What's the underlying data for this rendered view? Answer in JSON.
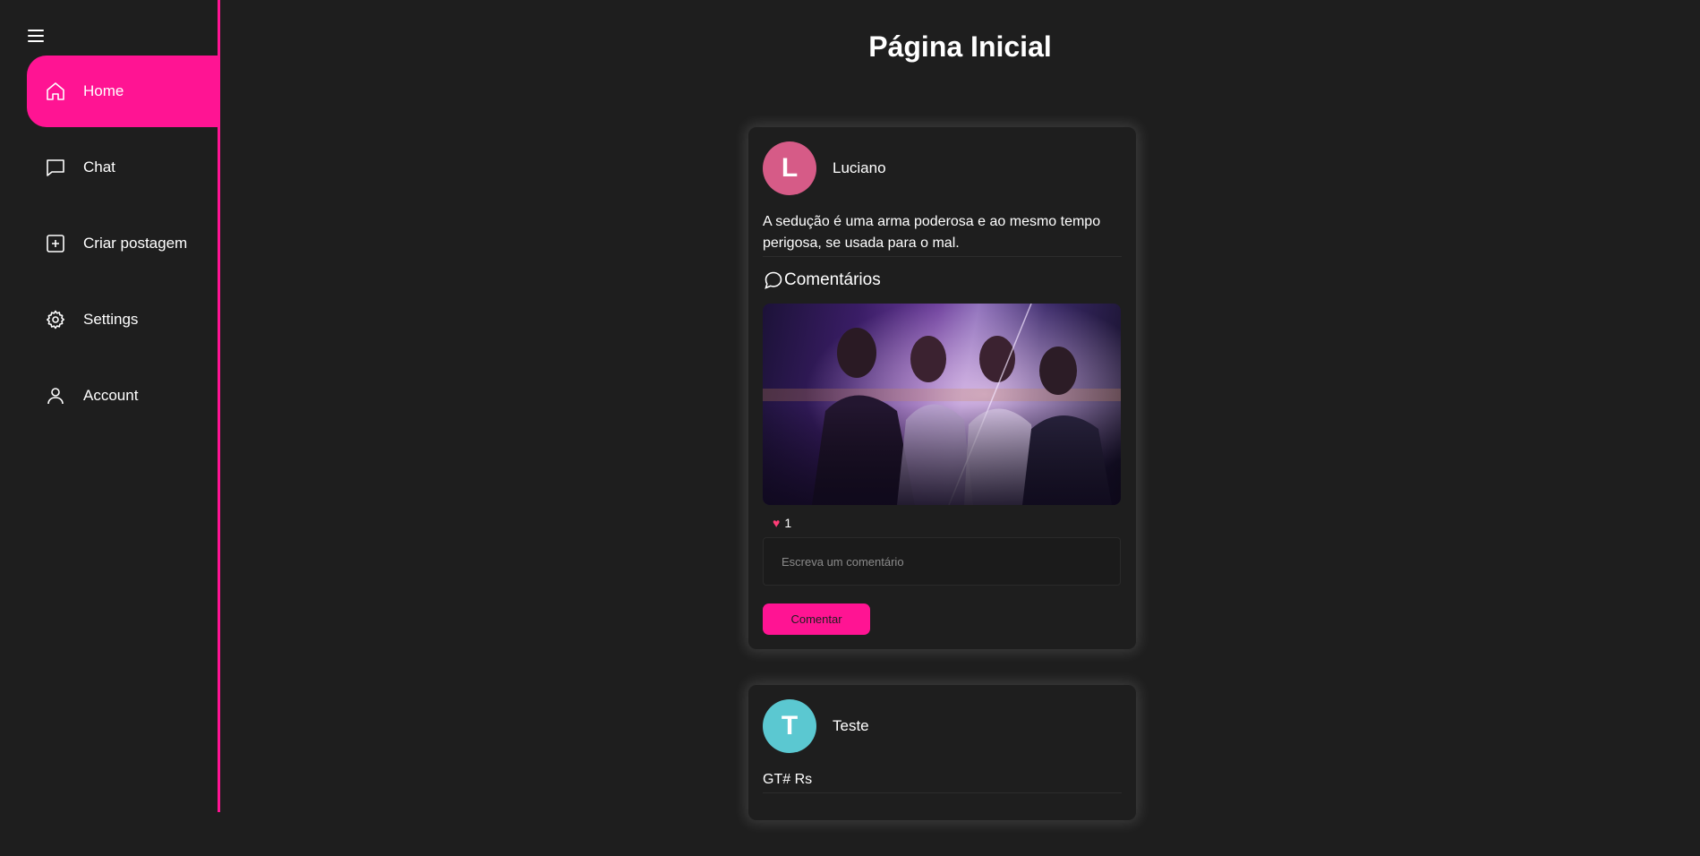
{
  "page": {
    "title": "Página Inicial"
  },
  "sidebar": {
    "items": [
      {
        "label": "Home",
        "icon": "home-icon",
        "active": true
      },
      {
        "label": "Chat",
        "icon": "chat-icon",
        "active": false
      },
      {
        "label": "Criar postagem",
        "icon": "plus-square-icon",
        "active": false
      },
      {
        "label": "Settings",
        "icon": "gear-icon",
        "active": false
      },
      {
        "label": "Account",
        "icon": "user-icon",
        "active": false
      }
    ]
  },
  "colors": {
    "accent": "#ff1493",
    "background": "#1e1e1e",
    "avatar_luciano": "#d65b87",
    "avatar_teste": "#5bc8d1"
  },
  "posts": [
    {
      "initial": "L",
      "author": "Luciano",
      "text": "A sedução é uma arma poderosa e ao mesmo tempo perigosa, se usada para o mal.",
      "comments_title": "Comentários",
      "likes": "1",
      "comment_placeholder": "Escreva um comentário",
      "comment_button": "Comentar"
    },
    {
      "initial": "T",
      "author": "Teste",
      "text": "GT# Rs"
    }
  ]
}
